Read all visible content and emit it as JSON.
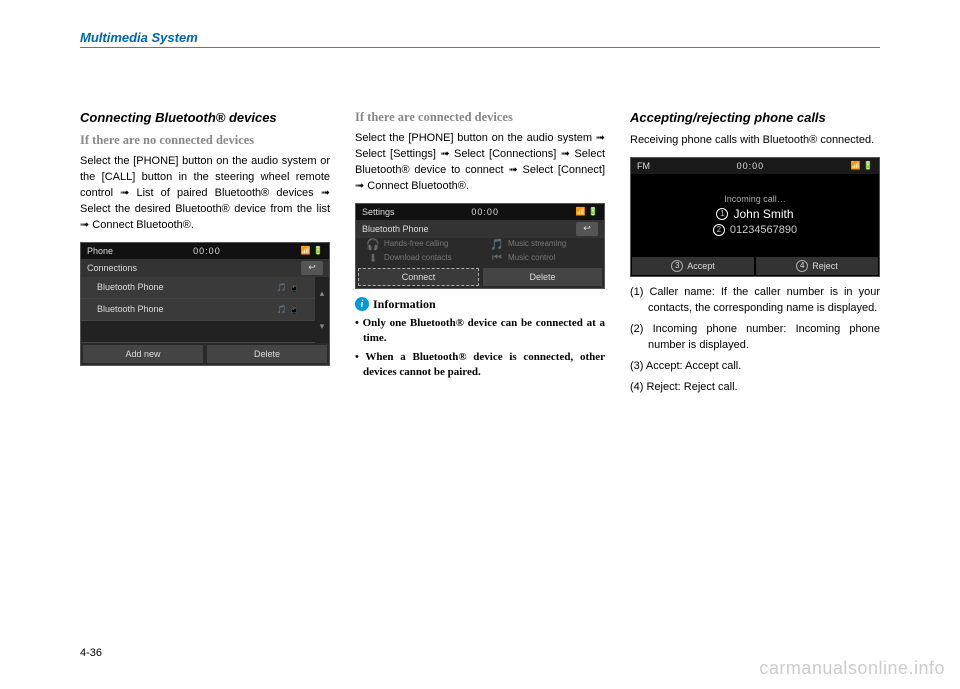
{
  "header": {
    "section": "Multimedia System"
  },
  "col1": {
    "heading": "Connecting Bluetooth® devices",
    "sub": "If there are no connected devices",
    "para": "Select the [PHONE] button on the audio system or the [CALL] button in the steering wheel remote control ➟ List of paired Bluetooth® devices ➟ Select the desired Bluetooth® device from the list ➟ Connect Bluetooth®.",
    "ss": {
      "mode": "Phone",
      "clock": "00:00",
      "subtitle": "Connections",
      "rows": [
        "Bluetooth Phone",
        "Bluetooth Phone"
      ],
      "btn_left": "Add new",
      "btn_right": "Delete"
    }
  },
  "col2": {
    "sub": "If there are connected devices",
    "para": "Select the [PHONE] button on the audio system ➟ Select [Settings] ➟ Select [Connections] ➟ Select Bluetooth® device to connect ➟ Select [Connect] ➟ Connect Bluetooth®.",
    "ss": {
      "mode": "Settings",
      "clock": "00:00",
      "subtitle": "Bluetooth Phone",
      "opts": [
        [
          "Hands-free calling",
          "Music streaming"
        ],
        [
          "Download contacts",
          "Music control"
        ]
      ],
      "btn_left": "Connect",
      "btn_right": "Delete"
    },
    "info_label": "Information",
    "info1": "• Only one Bluetooth® device can be connected at a time.",
    "info2": "• When a Bluetooth® device is connected, other devices cannot be paired."
  },
  "col3": {
    "heading": "Accepting/rejecting phone calls",
    "para": "Receiving phone calls with Bluetooth® connected.",
    "ss": {
      "mode": "FM",
      "clock": "00:00",
      "incoming": "Incoming call…",
      "name": "John Smith",
      "number": "01234567890",
      "accept": "Accept",
      "reject": "Reject"
    },
    "legend": {
      "l1": "(1) Caller name: If the caller number is in your contacts, the corresponding name is displayed.",
      "l2": "(2) Incoming phone number: Incoming phone number is displayed.",
      "l3": "(3) Accept: Accept call.",
      "l4": "(4) Reject: Reject call."
    }
  },
  "pagenum": "4-36",
  "watermark": "carmanualsonline.info"
}
